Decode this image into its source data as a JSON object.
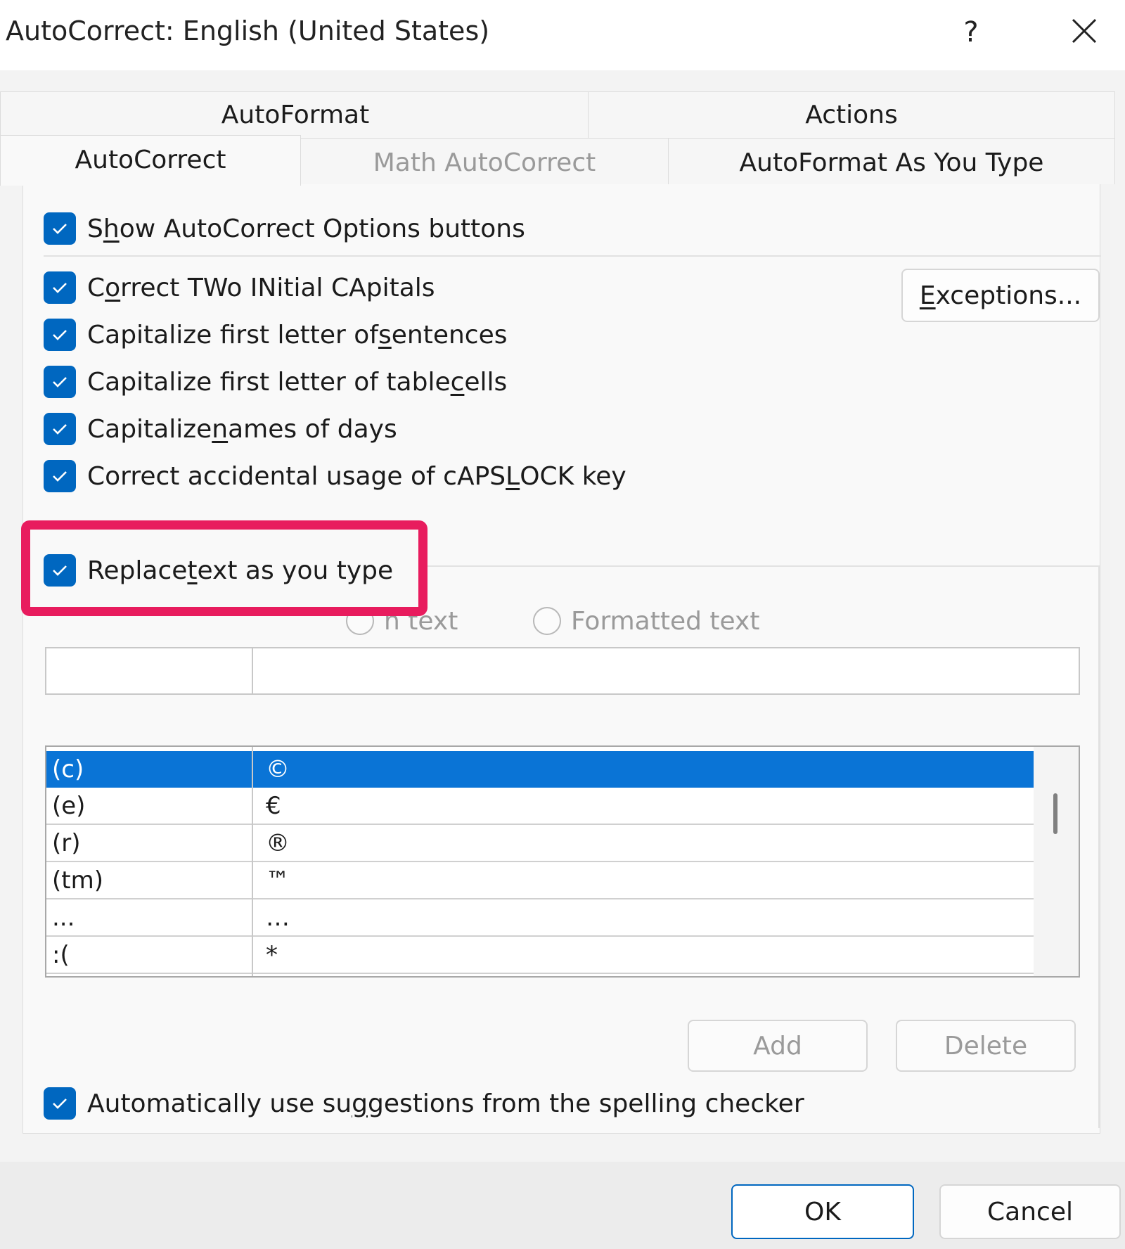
{
  "dialog": {
    "title": "AutoCorrect: English (United States)",
    "help_label": "?"
  },
  "tabs": {
    "row1": [
      {
        "label": "AutoFormat"
      },
      {
        "label": "Actions"
      }
    ],
    "row2": [
      {
        "label": "AutoCorrect",
        "active": true
      },
      {
        "label": "Math AutoCorrect",
        "disabled": true
      },
      {
        "label": "AutoFormat As You Type"
      }
    ]
  },
  "options": {
    "show_buttons": {
      "pre": "S",
      "u": "h",
      "post": "ow AutoCorrect Options buttons",
      "checked": true
    },
    "two_initials": {
      "pre": "C",
      "u": "o",
      "post": "rrect TWo INitial CApitals",
      "checked": true
    },
    "first_letter_sentences": {
      "pre": "Capitalize first letter of ",
      "u": "s",
      "post": "entences",
      "checked": true
    },
    "first_letter_cells": {
      "pre": "Capitalize first letter of table ",
      "u": "c",
      "post": "ells",
      "checked": true
    },
    "names_of_days": {
      "pre": "Capitalize ",
      "u": "n",
      "post": "ames of days",
      "checked": true
    },
    "caps_lock": {
      "pre": "Correct accidental usage of cAPS ",
      "u": "L",
      "post": "OCK key",
      "checked": true
    },
    "replace_text": {
      "pre": "Replace ",
      "u": "t",
      "post": "ext as you type",
      "checked": true
    },
    "spelling": {
      "pre": "Automatically use su",
      "u": "g",
      "post": "gestions from the spelling checker",
      "checked": true
    }
  },
  "buttons": {
    "exceptions": {
      "u": "E",
      "post": "xceptions..."
    },
    "add": "Add",
    "delete": "Delete",
    "ok": "OK",
    "cancel": "Cancel"
  },
  "format_options": {
    "plain_text": "n text",
    "formatted_text": "Formatted text"
  },
  "replace_inputs": {
    "replace_value": "",
    "with_value": ""
  },
  "entries": [
    {
      "replace": "(c)",
      "with": "©",
      "selected": true
    },
    {
      "replace": "(e)",
      "with": "€"
    },
    {
      "replace": "(r)",
      "with": "®"
    },
    {
      "replace": "(tm)",
      "with": "™"
    },
    {
      "replace": "...",
      "with": "…"
    },
    {
      "replace": ":(",
      "with": "*"
    }
  ],
  "colors": {
    "accent": "#0067c0",
    "selection": "#0a74d6",
    "highlight": "#e81c5e"
  }
}
